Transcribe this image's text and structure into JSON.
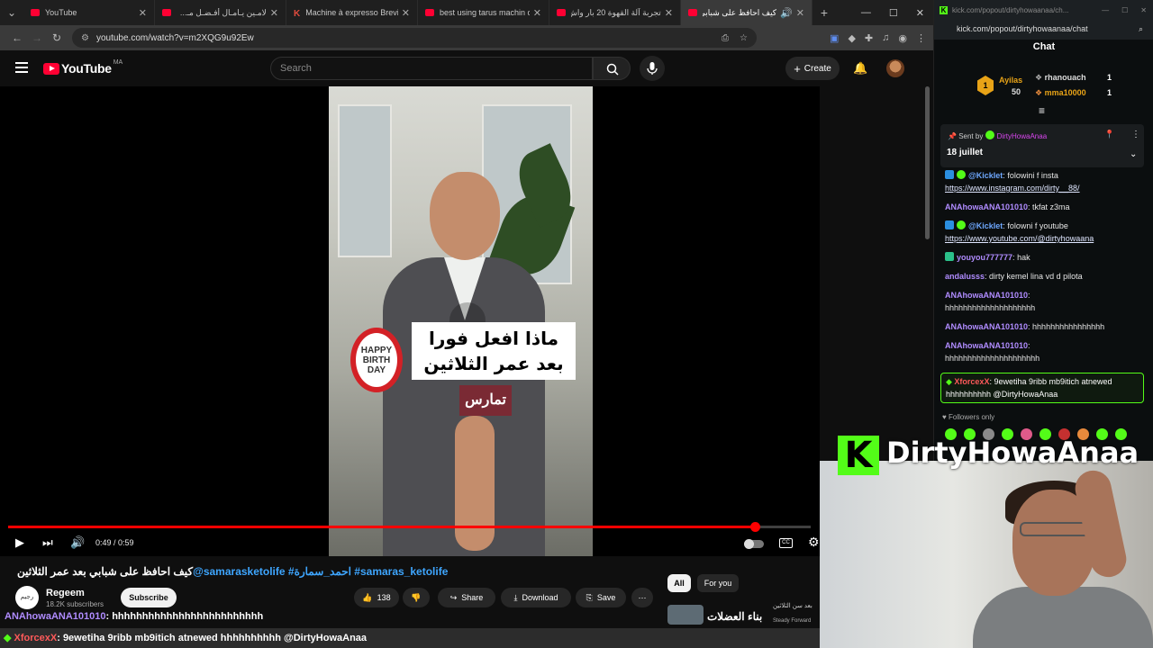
{
  "tabs": [
    {
      "title": "YouTube",
      "icon": "youtube-icon"
    },
    {
      "title": "لامـين يـامـال أفـضـل مـ...",
      "icon": "youtube-icon"
    },
    {
      "title": "Machine à expresso Brevill",
      "icon": "kick-icon"
    },
    {
      "title": "best using tarus machin ca",
      "icon": "youtube-icon"
    },
    {
      "title": "تجربة آلة القهوة 20 بار واش",
      "icon": "youtube-icon"
    },
    {
      "title": "كيف احافظ على شبابي",
      "icon": "youtube-icon"
    }
  ],
  "address": {
    "url": "youtube.com/watch?v=m2XQG9u92Ew"
  },
  "youtube": {
    "logo_text": "YouTube",
    "country": "MA",
    "search_placeholder": "Search",
    "create_label": "Create",
    "player": {
      "time": "0:49 / 0:59",
      "progress": 0.93,
      "caption_text": "ماذا افعل فورا بعد عمر الثلاثين",
      "badge_text": "HAPPY BIRTH DAY",
      "mic_text": "تمارس",
      "cc_label": "CC"
    },
    "video_title_main": "كيف احافظ على شبابي بعد عمر الثلاثين",
    "video_title_tags": "@samarasketolife #احمد_سمارة #samaras_ketolife",
    "channel": {
      "name": "Regeem",
      "subs": "18.2K subscribers",
      "avatar_text": "رجيم"
    },
    "subscribe_label": "Subscribe",
    "like_count": "138",
    "share_label": "Share",
    "download_label": "Download",
    "save_label": "Save",
    "chips": {
      "all": "All",
      "for_you": "For you"
    },
    "recommended": {
      "title": "بناء العضلات",
      "subtitle": "بعد سن الثلاثين",
      "channel": "Steady Forward"
    }
  },
  "kick": {
    "window_title": "kick.com/popout/dirtyhowaanaa/ch...",
    "url": "kick.com/popout/dirtyhowaanaa/chat",
    "heading": "Chat",
    "leaderboard": [
      {
        "rank": "1",
        "name": "Ayilas",
        "count": "50"
      },
      {
        "name": "rhanouach",
        "count": "1"
      },
      {
        "name": "mma10000",
        "count": "1"
      }
    ],
    "pinned": {
      "prefix": "Sent by",
      "sender": "DirtyHowaAnaa",
      "message": "18 juillet"
    },
    "messages": [
      {
        "user": "@Kicklet",
        "text": "folowini f insta",
        "link": "https://www.instagram.com/dirty__88/"
      },
      {
        "user": "ANAhowaANA101010",
        "text": "tkfat z3ma"
      },
      {
        "user": "@Kicklet",
        "text": "folowni f youtube",
        "link": "https://www.youtube.com/@dirtyhowaana"
      },
      {
        "user": "youyou777777",
        "text": "hak"
      },
      {
        "user": "andalusss",
        "text": "dirty kemel lina vd d pilota"
      },
      {
        "user": "ANAhowaANA101010",
        "text": "hhhhhhhhhhhhhhhhhhhh"
      },
      {
        "user": "ANAhowaANA101010",
        "text": "hhhhhhhhhhhhhhhh"
      },
      {
        "user": "ANAhowaANA101010",
        "text": "hhhhhhhhhhhhhhhhhhhhh"
      }
    ],
    "highlight": {
      "user": "XforcexX",
      "text": "9ewetiha 9ribb mb9itich atnewed hhhhhhhhhh @DirtyHowaAnaa"
    },
    "followers_only": "Followers only"
  },
  "overlay": {
    "brand_letter": "K",
    "brand_name": "DirtyHowaAnaa",
    "ticker_top_user": "ANAhowaANA101010",
    "ticker_top_text": ": hhhhhhhhhhhhhhhhhhhhhhhhh",
    "ticker_bottom_user": "XforcexX",
    "ticker_bottom_text": ": 9ewetiha 9ribb mb9itich atnewed hhhhhhhhhh @DirtyHowaAnaa"
  },
  "colors": {
    "kick_green": "#53fc18",
    "yt_red": "#ff0033"
  }
}
